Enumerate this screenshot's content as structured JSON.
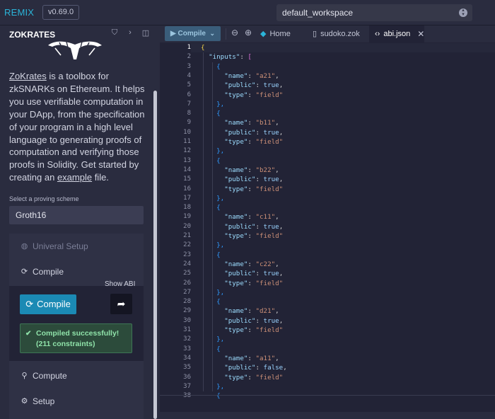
{
  "topbar": {
    "brand": "REMIX",
    "version": "v0.69.0",
    "workspace": "default_workspace"
  },
  "sidebar": {
    "title": "ZOKRATES",
    "description": {
      "link1": "ZoKrates",
      "part1": " is a toolbox for zkSNARKs on Ethereum. It helps you use verifiable computation in your DApp, from the specification of your program in a high level language to generating proofs of computation and verifying those proofs in Solidity. Get started by creating an ",
      "link2": "example",
      "part2": " file."
    },
    "scheme_label": "Select a proving scheme",
    "scheme_value": "Groth16",
    "items": {
      "universal_setup": "Univeral Setup",
      "compile": "Compile",
      "compute": "Compute",
      "setup": "Setup"
    },
    "compile_button": "Compile",
    "show_abi_tooltip": "Show ABI",
    "success_line1": "Compiled successfully!",
    "success_line2": "(211 constraints)"
  },
  "editor": {
    "run_button": "Compile",
    "tabs": {
      "home": "Home",
      "sudoko": "sudoko.zok",
      "abi": "abi.json"
    },
    "line_numbers": [
      "1",
      "2",
      "3",
      "4",
      "5",
      "6",
      "7",
      "8",
      "9",
      "10",
      "11",
      "12",
      "13",
      "14",
      "15",
      "16",
      "17",
      "18",
      "19",
      "20",
      "21",
      "22",
      "23",
      "24",
      "25",
      "26",
      "27",
      "28",
      "29",
      "30",
      "31",
      "32",
      "33",
      "34",
      "35",
      "36",
      "37",
      "38"
    ],
    "inputs": [
      {
        "name": "a21",
        "public": "true"
      },
      {
        "name": "b11",
        "public": "true"
      },
      {
        "name": "b22",
        "public": "true"
      },
      {
        "name": "c11",
        "public": "true"
      },
      {
        "name": "c22",
        "public": "true"
      },
      {
        "name": "d21",
        "public": "true"
      },
      {
        "name": "a11",
        "public": "false"
      }
    ],
    "tokens": {
      "open_brace": "{",
      "inputs_key": "\"inputs\"",
      "colon": ": ",
      "open_bracket": "[",
      "name_key": "\"name\"",
      "public_key": "\"public\"",
      "type_key": "\"type\"",
      "type_value": "\"field\"",
      "comma": ",",
      "close_obj": "},"
    }
  }
}
